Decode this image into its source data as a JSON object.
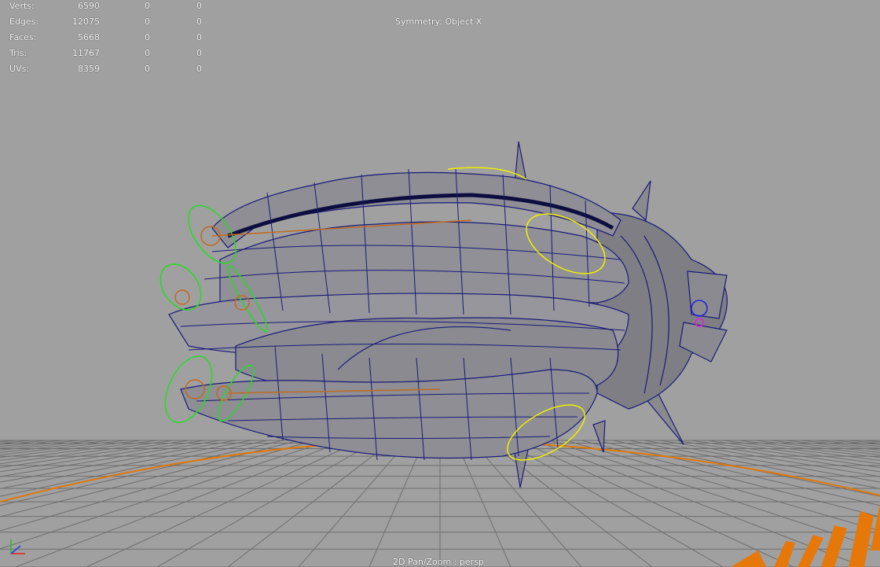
{
  "hud": {
    "rows": [
      {
        "label": "Verts:",
        "total": "6590",
        "selected": "0",
        "component": "0"
      },
      {
        "label": "Edges:",
        "total": "12075",
        "selected": "0",
        "component": "0"
      },
      {
        "label": "Faces:",
        "total": "5668",
        "selected": "0",
        "component": "0"
      },
      {
        "label": "Tris:",
        "total": "11767",
        "selected": "0",
        "component": "0"
      },
      {
        "label": "UVs:",
        "total": "8359",
        "selected": "0",
        "component": "0"
      }
    ]
  },
  "viewport": {
    "symmetry": "Symmetry: Object X",
    "camera": "2D Pan/Zoom : persp",
    "background_color": "#a0a0a0",
    "grid_color": "#707070",
    "wire_color": "#1a1a7a",
    "mesh_color": "#8c8c90",
    "controls": {
      "green_rings": "#22dd22",
      "yellow_rings": "#f0f000",
      "orange_joints": "#c06a20"
    }
  },
  "axis_icon": "xyz-axis-icon"
}
